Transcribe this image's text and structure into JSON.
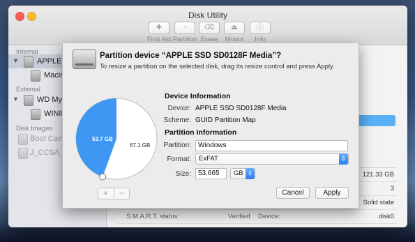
{
  "window": {
    "title": "Disk Utility",
    "toolbar": [
      {
        "label": "First Aid",
        "icon": "stethoscope-icon",
        "glyph": "✚"
      },
      {
        "label": "Partition",
        "icon": "partition-icon",
        "glyph": "◔"
      },
      {
        "label": "Erase",
        "icon": "erase-icon",
        "glyph": "⌫"
      },
      {
        "label": "Mount",
        "icon": "mount-icon",
        "glyph": "⏏"
      },
      {
        "label": "Info",
        "icon": "info-icon",
        "glyph": "ⓘ"
      }
    ]
  },
  "sidebar": {
    "internal_header": "Internal",
    "external_header": "External",
    "images_header": "Disk Images",
    "items": [
      {
        "label": "APPLE SS",
        "type": "disk"
      },
      {
        "label": "Macin",
        "type": "volume"
      },
      {
        "label": "WD My P",
        "type": "disk"
      },
      {
        "label": "WININ",
        "type": "volume"
      },
      {
        "label": "Boot Camp",
        "type": "image"
      },
      {
        "label": "J_CCSA_X6",
        "type": "image"
      }
    ]
  },
  "main": {
    "info_rows": [
      {
        "value": "121.33 GB"
      },
      {
        "value": "3"
      },
      {
        "value": "Solid state"
      },
      {
        "key1": "S.M.A.R.T. status:",
        "mid": "Verified",
        "key2": "Device:",
        "value": "disk0"
      }
    ]
  },
  "sheet": {
    "title": "Partition device “APPLE SSD SD0128F Media”?",
    "subtitle": "To resize a partition on the selected disk, drag its resize control and press Apply.",
    "device_info_title": "Device Information",
    "device_label": "Device:",
    "device_value": "APPLE SSD SD0128F Media",
    "scheme_label": "Scheme:",
    "scheme_value": "GUID Partition Map",
    "partition_info_title": "Partition Information",
    "partition_label": "Partition:",
    "partition_value": "Windows",
    "format_label": "Format:",
    "format_value": "ExFAT",
    "size_label": "Size:",
    "size_value": "53.665",
    "size_unit": "GB",
    "plus": "+",
    "minus": "−",
    "cancel": "Cancel",
    "apply": "Apply",
    "pie": {
      "slices": [
        {
          "label": "53.7 GB",
          "value": 53.7,
          "color": "#3d97f3"
        },
        {
          "label": "67.1 GB",
          "value": 67.1,
          "color": "#ffffff"
        }
      ]
    }
  }
}
